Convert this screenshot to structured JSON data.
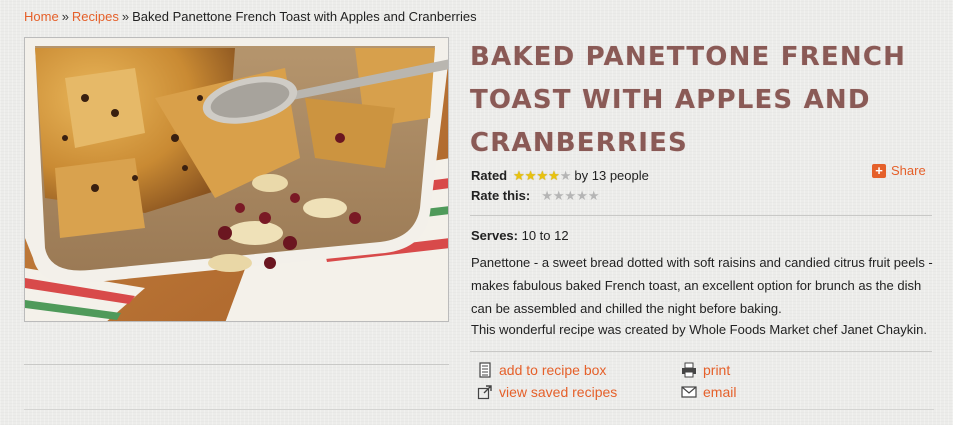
{
  "breadcrumb": {
    "home": "Home",
    "separator": "»",
    "recipes": "Recipes",
    "current": "Baked Panettone French Toast with Apples and Cranberries"
  },
  "recipe": {
    "title": "Baked Panettone French Toast with Apples and Cranberries",
    "rating": {
      "label": "Rated",
      "stars": 4,
      "max_stars": 5,
      "count_text": "by 13 people",
      "rate_label": "Rate this:"
    },
    "share_label": "Share",
    "serves_label": "Serves:",
    "serves_value": "10 to 12",
    "description": "Panettone - a sweet bread dotted with soft raisins and candied citrus fruit peels - makes fabulous baked French toast, an excellent option for brunch as the dish can be assembled and chilled the night before baking.",
    "credit": "This wonderful recipe was created by Whole Foods Market chef Janet Chaykin."
  },
  "actions": {
    "add_to_box": "add to recipe box",
    "view_saved": "view saved recipes",
    "print": "print",
    "email": "email"
  },
  "colors": {
    "link": "#e5602a",
    "title": "#8a5a56",
    "star_on": "#e9c20d",
    "star_off": "#b5b5b5"
  },
  "icons": {
    "share": "plus-icon",
    "add_to_box": "recipe-box-icon",
    "view_saved": "external-link-icon",
    "print": "printer-icon",
    "email": "envelope-icon"
  }
}
